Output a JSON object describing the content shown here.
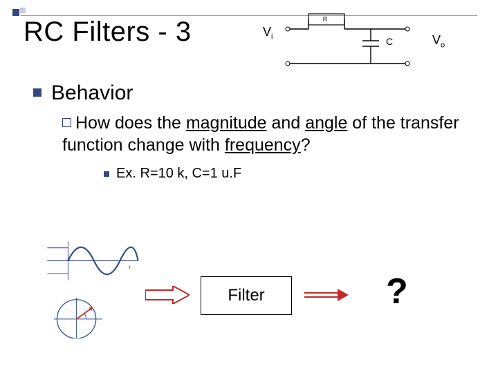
{
  "title": "RC Filters - 3",
  "circuit": {
    "vi": "V",
    "vi_sub": "i",
    "vo": "V",
    "vo_sub": "o",
    "r_label": "R",
    "c_label": "C"
  },
  "behavior_heading": "Behavior",
  "question": {
    "lead": "How",
    "text1": " does the ",
    "u1": "magnitude",
    "text2": " and ",
    "u2": "angle",
    "text3": " of the transfer function change with ",
    "u3": "frequency",
    "text4": "?"
  },
  "example": "Ex. R=10 k, C=1 u.F",
  "filter_label": "Filter",
  "output_placeholder": "?"
}
